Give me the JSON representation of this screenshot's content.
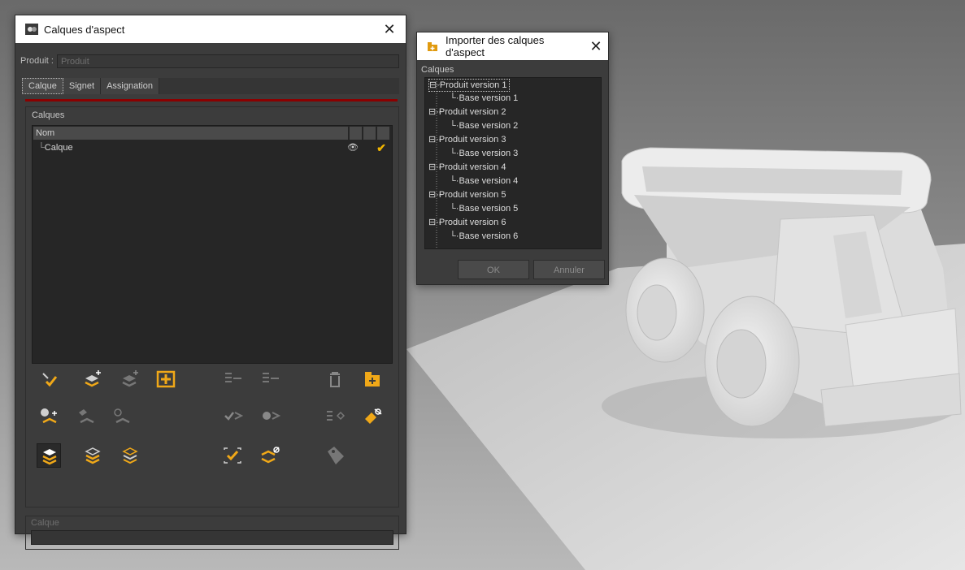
{
  "main_dialog": {
    "title": "Calques d'aspect",
    "produit_label": "Produit :",
    "produit_value": "Produit",
    "tabs": [
      {
        "label": "Calque",
        "active": true
      },
      {
        "label": "Signet",
        "active": false
      },
      {
        "label": "Assignation",
        "active": false
      }
    ],
    "group_calques_label": "Calques",
    "list_header_nom": "Nom",
    "layers": [
      {
        "name": "Calque",
        "visible_icon": "eye-icon",
        "active": true
      }
    ],
    "group_calque_label": "Calque"
  },
  "import_dialog": {
    "title": "Importer des calques d'aspect",
    "group_label": "Calques",
    "tree": [
      {
        "label": "Produit version 1",
        "child": "Base version 1"
      },
      {
        "label": "Produit version 2",
        "child": "Base version 2"
      },
      {
        "label": "Produit version 3",
        "child": "Base version 3"
      },
      {
        "label": "Produit version 4",
        "child": "Base version 4"
      },
      {
        "label": "Produit version 5",
        "child": "Base version 5"
      },
      {
        "label": "Produit version 6",
        "child": "Base version 6"
      }
    ],
    "ok_label": "OK",
    "cancel_label": "Annuler"
  },
  "colors": {
    "accent": "#f0a818",
    "tab_underline": "#8b0000",
    "dialog_bg": "#3c3c3c",
    "list_bg": "#262626"
  }
}
